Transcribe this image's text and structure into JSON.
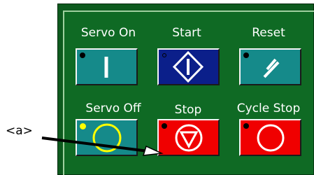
{
  "panel": {
    "labels": {
      "servo_on": "Servo On",
      "start": "Start",
      "reset": "Reset",
      "servo_off": "Servo Off",
      "stop": "Stop",
      "cycle_stop": "Cycle Stop"
    },
    "colors": {
      "panel_bg": "#0f6a24",
      "teal_button": "#158a8a",
      "navy_button": "#0b1f8a",
      "red_button": "#f00000",
      "indicator_yellow": "#ffff00"
    }
  },
  "annotation": {
    "label": "<a>"
  }
}
